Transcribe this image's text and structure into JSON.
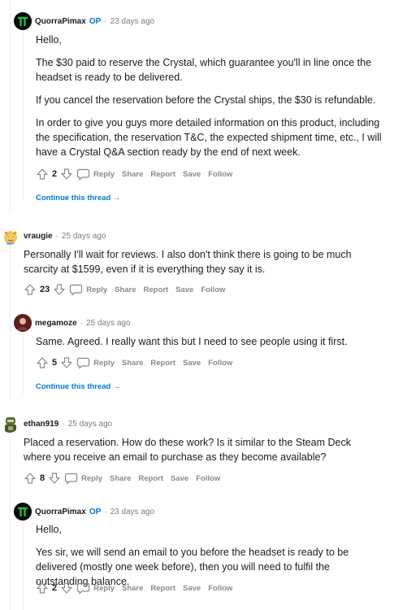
{
  "op_badge": "OP",
  "actions": {
    "reply": "Reply",
    "share": "Share",
    "report": "Report",
    "save": "Save",
    "follow": "Follow"
  },
  "continue_thread": "Continue this thread",
  "colors": {
    "accent": "#0079d3",
    "muted": "#878a8c",
    "thread_line": "#edeff1"
  },
  "comments": [
    {
      "author": "QuorraPimax",
      "is_op": true,
      "time": "23 days ago",
      "paragraphs": [
        "Hello,",
        "The $30 paid to reserve the Crystal, which guarantee you'll in line once the headset is ready to be delivered.",
        "If you cancel the reservation before the Crystal ships, the $30 is refundable.",
        "In order to give you guys more detailed information on this product, including the specification, the reservation T&C, the expected shipment time, etc., I will have a Crystal Q&A section ready by the end of next week."
      ],
      "votes": "2"
    },
    {
      "author": "vraugie",
      "is_op": false,
      "time": "25 days ago",
      "paragraphs": [
        "Personally I'll wait for reviews. I also don't think there is going to be much scarcity at $1599, even if it is everything they say it is."
      ],
      "votes": "23"
    },
    {
      "author": "megamoze",
      "is_op": false,
      "time": "25 days ago",
      "paragraphs": [
        "Same. Agreed. I really want this but I need to see people using it first."
      ],
      "votes": "5"
    },
    {
      "author": "ethan919",
      "is_op": false,
      "time": "25 days ago",
      "paragraphs": [
        "Placed a reservation. How do these work? Is it similar to the Steam Deck where you receive an email to purchase as they become available?"
      ],
      "votes": "8"
    },
    {
      "author": "QuorraPimax",
      "is_op": true,
      "time": "23 days ago",
      "paragraphs": [
        "Hello,",
        "Yes sir, we will send an email to you before the headset is ready to be delivered (mostly one week before), then you will need to fulfil the outstanding balance."
      ],
      "votes": "2"
    }
  ]
}
